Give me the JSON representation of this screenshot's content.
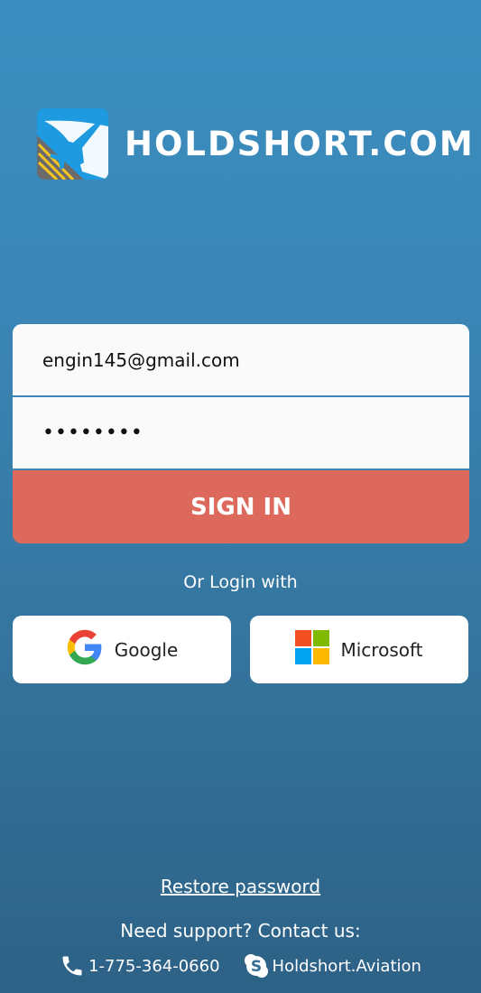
{
  "brand": {
    "name": "HOLDSHORT.COM"
  },
  "form": {
    "email_value": "engin145@gmail.com",
    "password_masked": "••••••••",
    "signin_label": "SIGN IN"
  },
  "social": {
    "or_label": "Or Login with",
    "google_label": "Google",
    "microsoft_label": "Microsoft"
  },
  "footer": {
    "restore_label": "Restore password",
    "support_label": "Need support? Contact us:",
    "phone": "1-775-364-0660",
    "skype": "Holdshort.Aviation"
  },
  "colors": {
    "accent_signin": "#dd685c",
    "bg_top": "#3a8fc0",
    "bg_bottom": "#2d6186"
  },
  "icons": [
    "airplane-logo-icon",
    "google-icon",
    "microsoft-icon",
    "phone-icon",
    "skype-icon"
  ]
}
